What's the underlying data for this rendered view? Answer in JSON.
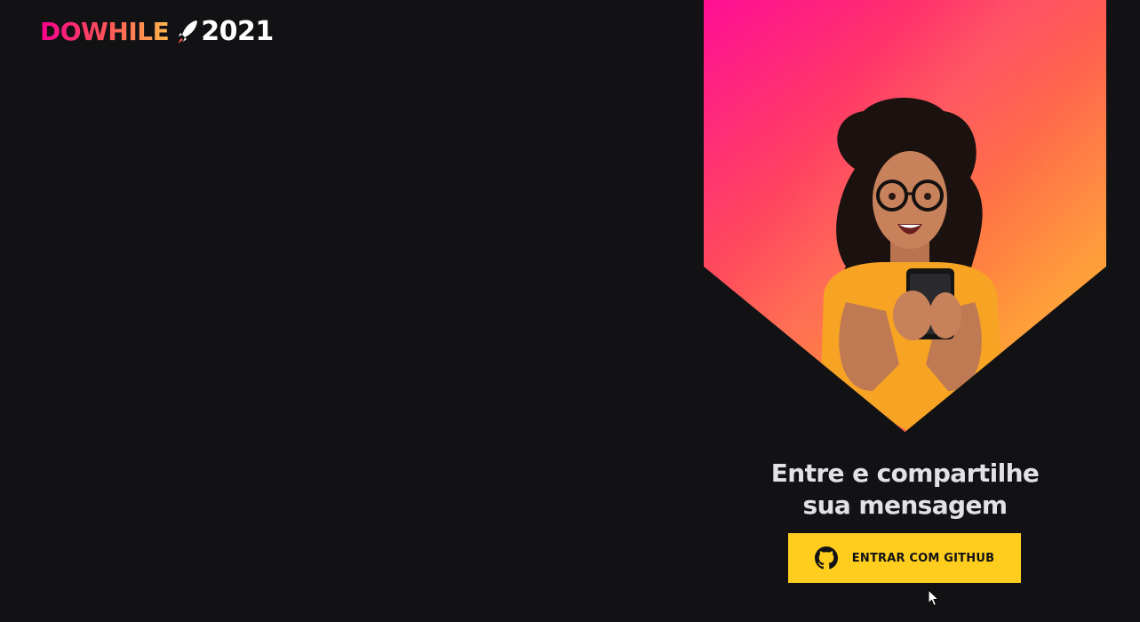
{
  "header": {
    "logo_text": "DOWHILE",
    "logo_year": "2021",
    "logo_icon": "rocket-icon"
  },
  "login": {
    "title_line1": "Entre e compartilhe",
    "title_line2": "sua mensagem",
    "button_label": "ENTRAR COM GITHUB",
    "button_icon": "github-icon"
  },
  "colors": {
    "background": "#121214",
    "button": "#ffcd1e",
    "title_text": "#e1e1e6",
    "gradient_start": "#ff008e",
    "gradient_end": "#ffb42a"
  }
}
